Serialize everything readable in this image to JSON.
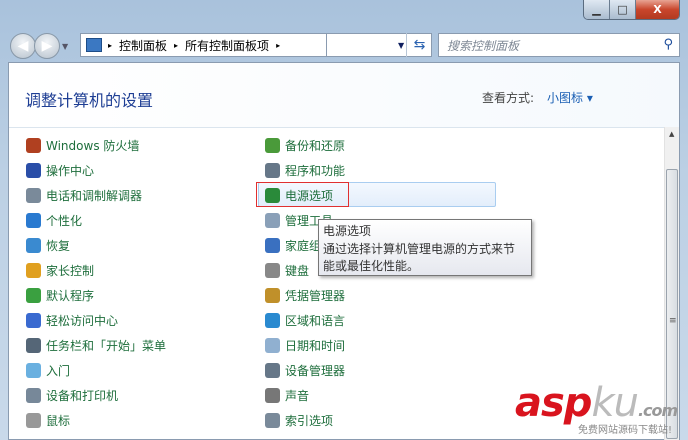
{
  "window": {
    "minimize": "▁",
    "maximize": "□",
    "close": "X"
  },
  "address": {
    "crumbs": [
      "控制面板",
      "所有控制面板项"
    ],
    "separator": "▸"
  },
  "search": {
    "placeholder": "搜索控制面板"
  },
  "header": {
    "title": "调整计算机的设置",
    "view_label": "查看方式:",
    "view_value": "小图标 ▾"
  },
  "items_left": [
    {
      "label": "Windows 防火墙",
      "color": "#b04020"
    },
    {
      "label": "操作中心",
      "color": "#2a4ea8"
    },
    {
      "label": "电话和调制解调器",
      "color": "#7a8a9a"
    },
    {
      "label": "个性化",
      "color": "#2a7ad0"
    },
    {
      "label": "恢复",
      "color": "#3a8ad0"
    },
    {
      "label": "家长控制",
      "color": "#e0a020"
    },
    {
      "label": "默认程序",
      "color": "#3aa040"
    },
    {
      "label": "轻松访问中心",
      "color": "#3a6ad0"
    },
    {
      "label": "任务栏和「开始」菜单",
      "color": "#556677"
    },
    {
      "label": "入门",
      "color": "#6ab0e0"
    },
    {
      "label": "设备和打印机",
      "color": "#778899"
    },
    {
      "label": "鼠标",
      "color": "#999999"
    }
  ],
  "items_right": [
    {
      "label": "备份和还原",
      "color": "#4a9a3a"
    },
    {
      "label": "程序和功能",
      "color": "#667788"
    },
    {
      "label": "电源选项",
      "color": "#2a8a3a"
    },
    {
      "label": "管理工具",
      "color": "#8aa0b8"
    },
    {
      "label": "家庭组",
      "color": "#3a70c0"
    },
    {
      "label": "键盘",
      "color": "#888888"
    },
    {
      "label": "凭据管理器",
      "color": "#c0902a"
    },
    {
      "label": "区域和语言",
      "color": "#2a8ad0"
    },
    {
      "label": "日期和时间",
      "color": "#90b0d0"
    },
    {
      "label": "设备管理器",
      "color": "#667788"
    },
    {
      "label": "声音",
      "color": "#777777"
    },
    {
      "label": "索引选项",
      "color": "#7a8a9a"
    }
  ],
  "tooltip": {
    "title": "电源选项",
    "line1": "通过选择计算机管理电源的方式来节",
    "line2": "能或最佳化性能。"
  },
  "watermark": {
    "brand": "asp",
    "brand2": "ku",
    "tld": ".com",
    "sub": "免费网站源码下载站!"
  }
}
